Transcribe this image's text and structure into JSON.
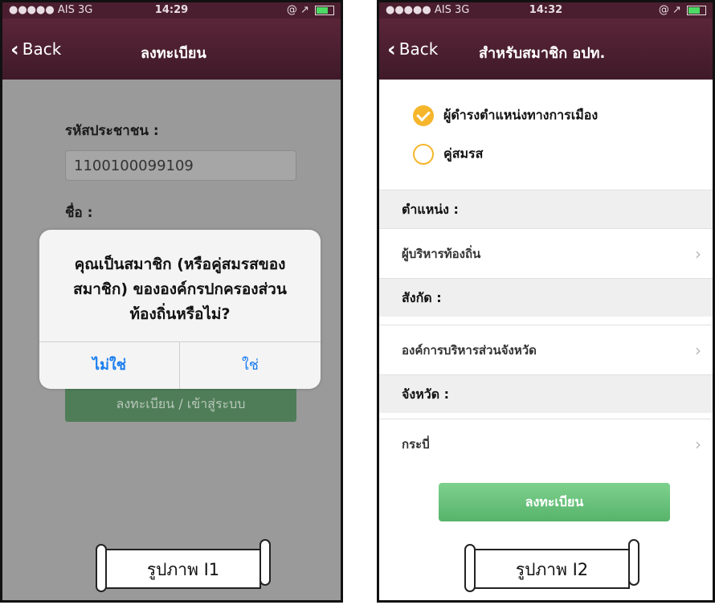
{
  "screen1": {
    "status": {
      "carrier": "●●●●● AIS 3G",
      "time": "14:29",
      "right": "@ ↗"
    },
    "nav": {
      "back": "Back",
      "title": "ลงทะเบียน"
    },
    "id_label": "รหัสประชาชน :",
    "id_value": "1100100099109",
    "name_label": "ชื่อ :",
    "register_button": "ลงทะเบียน / เข้าสู่ระบบ",
    "alert": {
      "message_line1": "คุณเป็นสมาชิก (หรือคู่สมรสของ",
      "message_line2": "สมาชิก) ขององค์กรปกครองส่วน",
      "message_line3": "ท้องถิ่นหรือไม่?",
      "no": "ไม่ใช่",
      "yes": "ใช่"
    },
    "caption": "รูปภาพ I1"
  },
  "screen2": {
    "status": {
      "carrier": "●●●●● AIS 3G",
      "time": "14:32",
      "right": "@ ↗"
    },
    "nav": {
      "back": "Back",
      "title": "สำหรับสมาชิก อปท."
    },
    "options": [
      {
        "label": "ผู้ดำรงตำแหน่งทางการเมือง",
        "checked": true
      },
      {
        "label": "คู่สมรส",
        "checked": false
      }
    ],
    "position_label": "ตำแหน่ง :",
    "position_value": "ผู้บริหารท้องถิ่น",
    "affiliation_label": "สังกัด :",
    "affiliation_value": "องค์การบริหารส่วนจังหวัด",
    "province_label": "จังหวัด :",
    "province_value": "กระบี่",
    "register_button": "ลงทะเบียน",
    "caption": "รูปภาพ I2"
  },
  "colors": {
    "navbar": "#4a1e2e",
    "radio": "#f5b62c",
    "button_green": "#5cb870",
    "alert_link": "#1a7df0"
  }
}
